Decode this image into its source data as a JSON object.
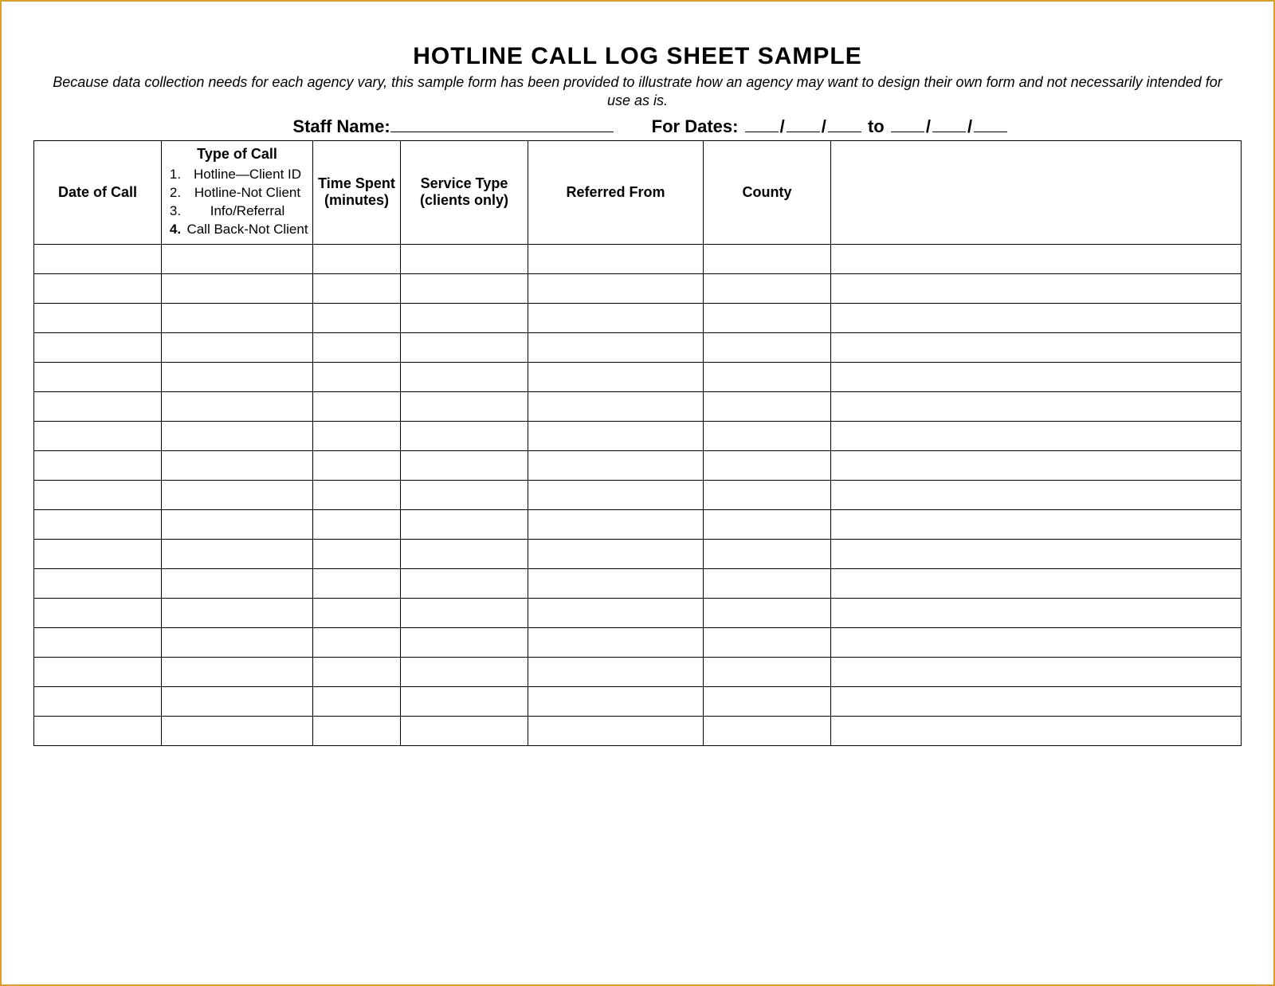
{
  "title": "HOTLINE CALL LOG SHEET SAMPLE",
  "subtitle": "Because data collection needs for each agency vary, this sample form has been provided to illustrate how an agency may want to design their own form and not necessarily intended for use as is.",
  "meta": {
    "staff_label": "Staff Name:",
    "dates_label": "For Dates:",
    "to_label": "to"
  },
  "columns": {
    "date": "Date of Call",
    "type_title": "Type of Call",
    "type_items": [
      {
        "num": "1.",
        "label": "Hotline—Client ID",
        "bold": false
      },
      {
        "num": "2.",
        "label": "Hotline-Not Client",
        "bold": false
      },
      {
        "num": "3.",
        "label": "Info/Referral",
        "bold": false
      },
      {
        "num": "4.",
        "label": "Call Back-Not Client",
        "bold": true
      }
    ],
    "time": "Time Spent (minutes)",
    "service": "Service Type (clients only)",
    "referred": "Referred From",
    "county": "County"
  },
  "row_count": 17
}
